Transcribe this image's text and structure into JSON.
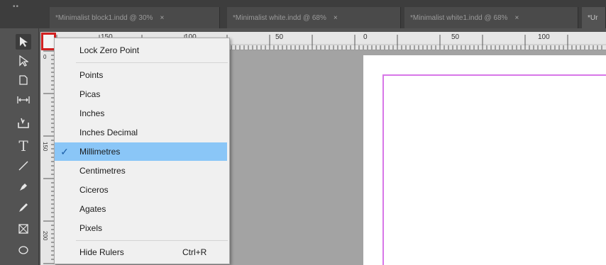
{
  "tabs": [
    {
      "label": "*Minimalist block1.indd @ 30%",
      "close": "×"
    },
    {
      "label": "*Minimalist white.indd @ 68%",
      "close": "×"
    },
    {
      "label": "*Minimalist white1.indd @ 68%",
      "close": "×"
    },
    {
      "label": "*Ur",
      "close": ""
    }
  ],
  "tab_grip": "••",
  "rulers": {
    "h_labels": [
      "150",
      "100",
      "50",
      "0",
      "50",
      "100"
    ],
    "v_labels": [
      "0",
      "150",
      "200"
    ]
  },
  "context_menu": {
    "lock_zero_point": "Lock Zero Point",
    "units": [
      {
        "label": "Points",
        "checked": false
      },
      {
        "label": "Picas",
        "checked": false
      },
      {
        "label": "Inches",
        "checked": false
      },
      {
        "label": "Inches Decimal",
        "checked": false
      },
      {
        "label": "Millimetres",
        "checked": true
      },
      {
        "label": "Centimetres",
        "checked": false
      },
      {
        "label": "Ciceros",
        "checked": false
      },
      {
        "label": "Agates",
        "checked": false
      },
      {
        "label": "Pixels",
        "checked": false
      }
    ],
    "hide_rulers": "Hide Rulers",
    "hide_rulers_shortcut": "Ctrl+R",
    "check_glyph": "✓"
  },
  "colors": {
    "highlight": "#8ac6f7",
    "corner_outline": "#d12020",
    "margin_guide": "#d877e8"
  },
  "tools": [
    "selection-tool",
    "direct-selection-tool",
    "page-tool",
    "gap-tool",
    "content-collector-tool",
    "type-tool",
    "line-tool",
    "pen-tool",
    "pencil-tool",
    "rectangle-frame-tool",
    "ellipse-tool"
  ]
}
